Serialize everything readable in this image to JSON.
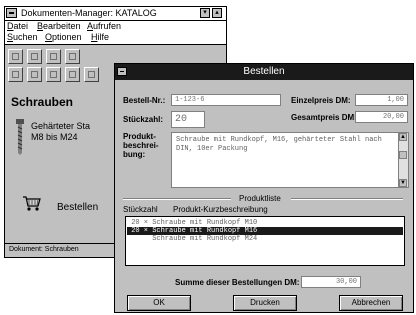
{
  "bg_window": {
    "title": "Dokumenten-Manager: KATALOG",
    "title_buttons": [
      "▾",
      "▴"
    ],
    "menu": {
      "row1": [
        "Datei",
        "Bearbeiten",
        "Aufrufen"
      ],
      "row2": [
        "Suchen",
        "Optionen",
        "Hilfe"
      ]
    },
    "heading": "Schrauben",
    "product_desc": {
      "line1": "Gehärteter Sta",
      "line2": "M8 bis M24"
    },
    "order_label": "Bestellen",
    "status": "Dokument: Schrauben"
  },
  "dialog": {
    "title": "Bestellen",
    "bestell_nr": {
      "label": "Bestell-Nr.:",
      "value": "1-123-6"
    },
    "stueckzahl": {
      "label": "Stückzahl:",
      "value": "20"
    },
    "einzelpreis": {
      "label": "Einzelpreis DM:",
      "value": "1,00"
    },
    "gesamtpreis": {
      "label": "Gesamtpreis DM:",
      "value": "20,00"
    },
    "beschreibung": {
      "label_lines": [
        "Produkt-",
        "beschrei-",
        "bung:"
      ],
      "text": "Schraube mit Rundkopf, M16, gehärteter Stahl nach DIN, 10er Packung"
    },
    "produktliste": {
      "section_title": "Produktliste",
      "col_qty": "Stückzahl",
      "col_desc": "Produkt-Kurzbeschreibung",
      "rows": [
        {
          "text": " 20 × Schraube mit Rundkopf M10",
          "selected": false
        },
        {
          "text": " 20 × Schraube mit Rundkopf M16",
          "selected": true
        },
        {
          "text": "      Schraube mit Rundkopf M24",
          "selected": false
        }
      ]
    },
    "summe": {
      "label": "Summe dieser Bestellungen DM:",
      "value": "30,00"
    },
    "buttons": {
      "ok": "OK",
      "drucken": "Drucken",
      "abbrechen": "Abbrechen"
    }
  }
}
